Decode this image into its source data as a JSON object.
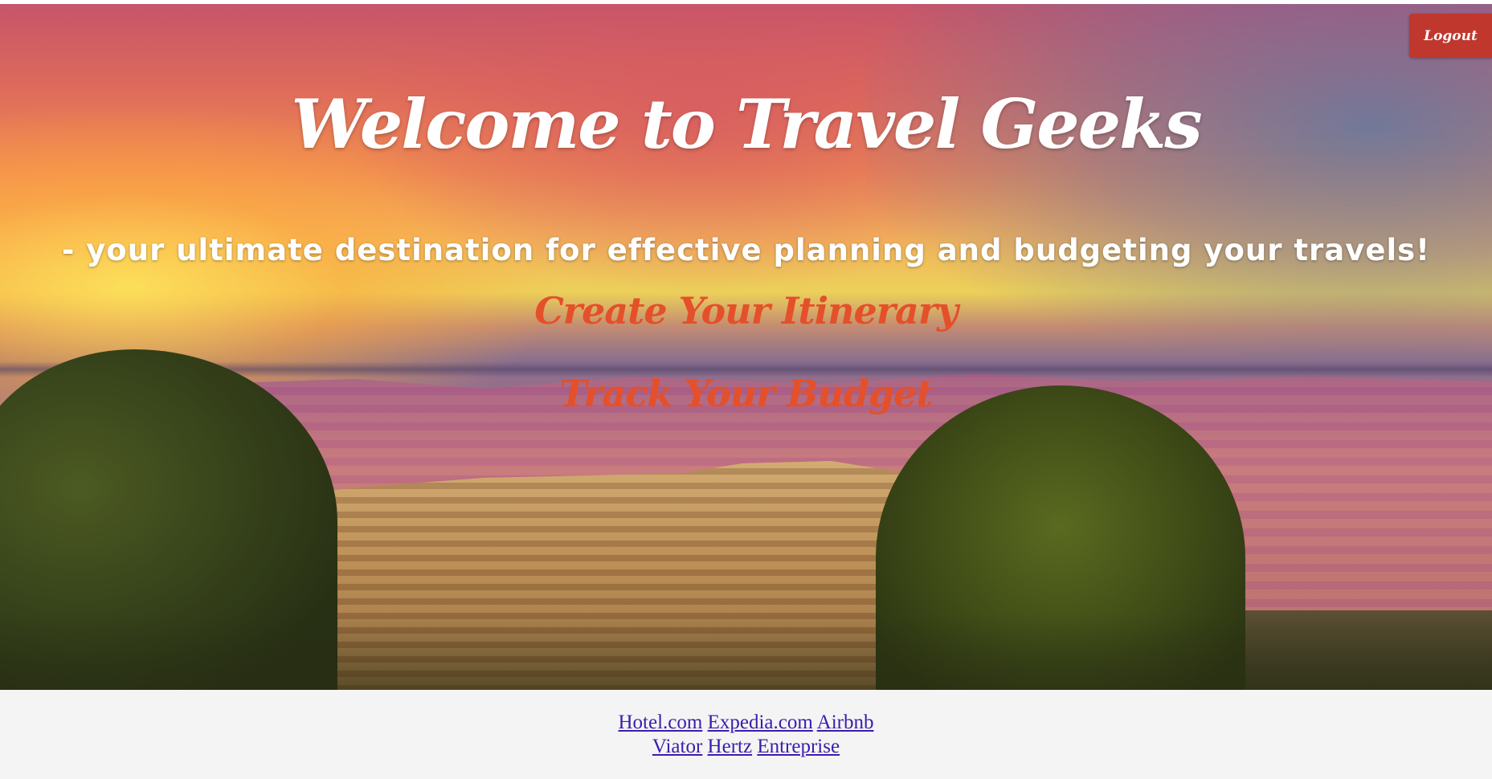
{
  "header": {
    "logout_label": "Logout"
  },
  "hero": {
    "title": "Welcome to Travel Geeks",
    "tagline": "- your ultimate destination for effective planning and budgeting your travels!",
    "links": {
      "itinerary": "Create Your Itinerary",
      "budget": "Track Your Budget"
    }
  },
  "footer": {
    "row1": [
      "Hotel.com",
      "Expedia.com",
      "Airbnb"
    ],
    "row2": [
      "Viator",
      "Hertz",
      "Entreprise"
    ]
  },
  "colors": {
    "logout_bg": "#c0372d",
    "hero_link": "#e4502a",
    "footer_bg": "#f4f4f4",
    "footer_link": "#3b1dad"
  }
}
